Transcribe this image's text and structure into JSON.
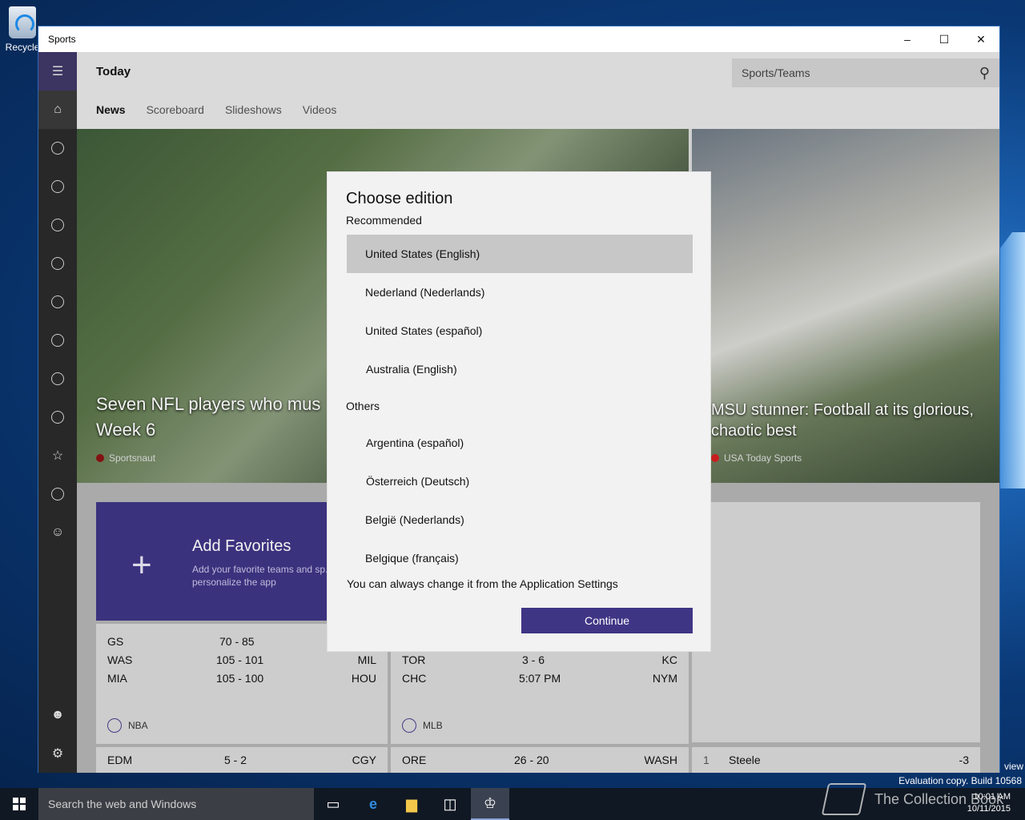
{
  "desktop": {
    "recycle_label": "Recycle",
    "preview_label": "view",
    "eval_label": "Evaluation copy. Build 10568"
  },
  "window": {
    "title": "Sports",
    "min": "–",
    "max": "☐",
    "close": "✕"
  },
  "app": {
    "header_title": "Today",
    "search_placeholder": "Sports/Teams",
    "tabs": [
      "News",
      "Scoreboard",
      "Slideshows",
      "Videos"
    ],
    "hero": [
      {
        "title": "Seven NFL players who mus",
        "title2": "Week 6",
        "source": "Sportsnaut"
      },
      {
        "title": "MSU stunner: Football at its glorious,",
        "title2": "chaotic best",
        "source": "USA Today Sports"
      }
    ],
    "favorites": {
      "title": "Add Favorites",
      "desc": "Add your favorite teams and sp... personalize the app",
      "plus": "+"
    },
    "nba": {
      "rows": [
        {
          "home": "GS",
          "score": "70  -  85",
          "away": ""
        },
        {
          "home": "WAS",
          "score": "105  -  101",
          "away": "MIL"
        },
        {
          "home": "MIA",
          "score": "105  -  100",
          "away": "HOU"
        }
      ],
      "league": "NBA"
    },
    "mlb": {
      "rows": [
        {
          "home": "TOR",
          "score": "3  -  6",
          "away": "KC"
        },
        {
          "home": "CHC",
          "score": "5:07 PM",
          "away": "NYM"
        }
      ],
      "league": "MLB"
    },
    "nhl": {
      "home": "EDM",
      "score": "5  -  2",
      "away": "CGY"
    },
    "ncaa": {
      "home": "ORE",
      "score": "26  -  20",
      "away": "WASH"
    },
    "golf": {
      "rank": "1",
      "name": "Steele",
      "score": "-3"
    }
  },
  "dialog": {
    "title": "Choose edition",
    "recommended_label": "Recommended",
    "recommended": [
      "United States (English)",
      "Nederland (Nederlands)",
      "United States (español)",
      "Australia (English)"
    ],
    "others_label": "Others",
    "others": [
      "Argentina (español)",
      "Österreich (Deutsch)",
      "België (Nederlands)",
      "Belgique (français)"
    ],
    "note": "You can always change it from the Application Settings",
    "continue": "Continue"
  },
  "taskbar": {
    "search_placeholder": "Search the web and Windows",
    "time": "10:01 AM",
    "date": "10/11/2015",
    "watermark": "The Collection Book"
  },
  "colors": {
    "accent": "#3f3585",
    "selected_option": "#c7c7c7",
    "taskbar": "#101823"
  }
}
